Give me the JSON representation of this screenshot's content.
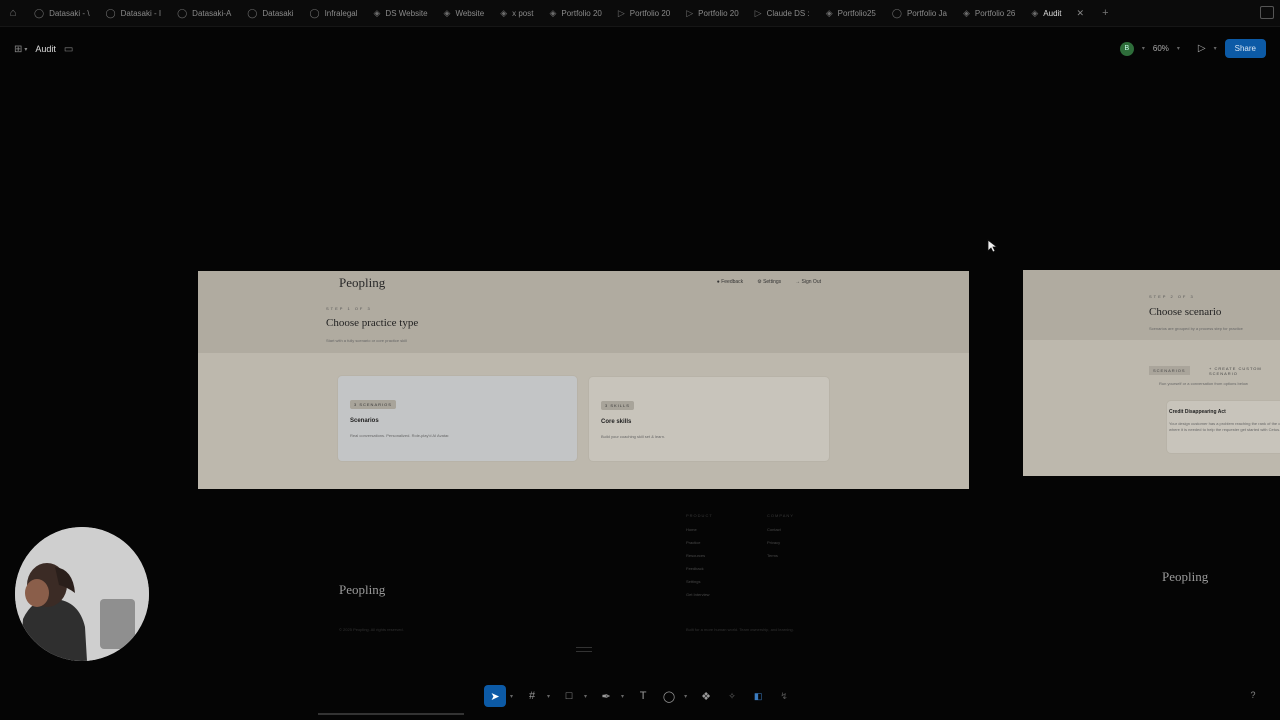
{
  "tabs": [
    {
      "icon": "comment-icon",
      "label": "Datasaki - \\"
    },
    {
      "icon": "comment-icon",
      "label": "Datasaki - I"
    },
    {
      "icon": "comment-icon",
      "label": "Datasaki-A"
    },
    {
      "icon": "comment-icon",
      "label": "Datasaki"
    },
    {
      "icon": "comment-icon",
      "label": "Infralegal"
    },
    {
      "icon": "design-icon",
      "label": "DS Website"
    },
    {
      "icon": "design-icon",
      "label": "Website"
    },
    {
      "icon": "design-icon",
      "label": "x post"
    },
    {
      "icon": "design-icon",
      "label": "Portfolio 20"
    },
    {
      "icon": "play-icon",
      "label": "Portfolio 20"
    },
    {
      "icon": "play-icon",
      "label": "Portfolio 20"
    },
    {
      "icon": "play-icon",
      "label": "Claude DS :"
    },
    {
      "icon": "design-icon",
      "label": "Portfolio25"
    },
    {
      "icon": "comment-icon",
      "label": "Portfolio Ja"
    },
    {
      "icon": "design-icon",
      "label": "Portfolio 26"
    },
    {
      "icon": "design-icon",
      "label": "Audit",
      "active": true
    }
  ],
  "toolbar": {
    "file_name": "Audit",
    "avatar_initial": "B",
    "zoom": "60%",
    "share_label": "Share"
  },
  "frame1": {
    "logo": "Peopling",
    "nav": [
      "Feedback",
      "Settings",
      "Sign Out"
    ],
    "step": "STEP 1 OF 3",
    "title": "Choose practice type",
    "subtitle": "Start with a fully scenario or core practice skill",
    "cards": [
      {
        "badge": "3 SCENARIOS",
        "title": "Scenarios",
        "desc": "Real conversations. Personalized. Role-play'd AI Avatar."
      },
      {
        "badge": "3 SKILLS",
        "title": "Core skills",
        "desc": "Build your coaching skill set & learn."
      }
    ]
  },
  "frame2": {
    "step": "STEP 2 OF 3",
    "title": "Choose scenario",
    "subtitle": "Scenarios are grouped by a process step for practice",
    "filter": "SCENARIOS",
    "create": "CREATE CUSTOM SCENARIO",
    "hint": "Run yourself or a conversation from options below",
    "card_title": "Credit Disappearing Act",
    "card_desc": "Your design customer has a problem reaching the rank of the client where it is needed to help the requester get started with Cetus."
  },
  "footer": {
    "logo": "Peopling",
    "col1_head": "PRODUCT",
    "col1": [
      "Home",
      "Practice",
      "Resources",
      "Feedback",
      "Settings",
      "Get Interview"
    ],
    "col2_head": "COMPANY",
    "col2": [
      "Contact",
      "Privacy",
      "Terms"
    ],
    "copyright": "© 2025 Peopling. All rights reserved.",
    "bottom": "Built for a more human world. Team ownership, and learning.",
    "logo2": "Peopling"
  }
}
